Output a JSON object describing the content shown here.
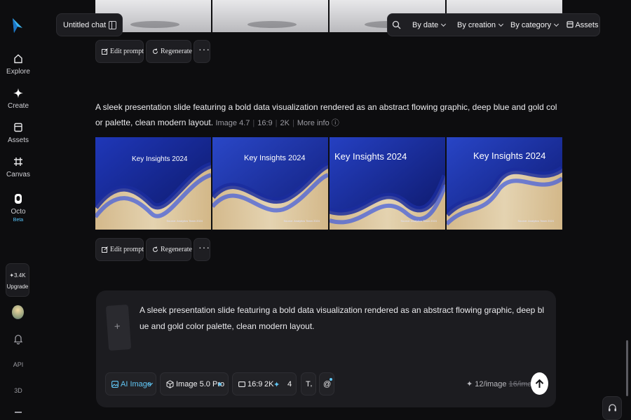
{
  "sidebar": {
    "items": [
      {
        "label": "Explore",
        "icon": "home-icon"
      },
      {
        "label": "Create",
        "icon": "sparkle-icon"
      },
      {
        "label": "Assets",
        "icon": "folder-icon"
      },
      {
        "label": "Canvas",
        "icon": "hash-icon"
      },
      {
        "label": "Octo",
        "icon": "octo-icon",
        "badge": "Beta"
      }
    ],
    "credits": "3.4K",
    "upgrade_label": "Upgrade",
    "api_label": "API",
    "threed_label": "3D"
  },
  "header": {
    "chat_title": "Untitled chat",
    "filters": [
      "By date",
      "By creation",
      "By category"
    ],
    "assets_label": "Assets"
  },
  "result": {
    "prompt": "A sleek presentation slide featuring a bold data visualization rendered as an abstract flowing graphic, deep blue and gold color palette, clean modern layout.",
    "model": "Image 4.7",
    "ratio": "16:9",
    "resolution": "2K",
    "more_info": "More info",
    "slide_title": "Key Insights 2024",
    "slide_source": "Source: Analytics Team 2024",
    "colors": {
      "deep_blue": "#1b2d9e",
      "gold": "#e4c58a"
    }
  },
  "actions": {
    "edit_prompt": "Edit prompt",
    "regenerate": "Regenerate",
    "more": "···"
  },
  "composer": {
    "text": "A sleek presentation slide featuring a bold data visualization rendered as an abstract flowing graphic, deep blue and gold color palette, clean modern layout.",
    "add_symbol": "+",
    "mode": "AI Image",
    "model": "Image 5.0 Pro",
    "ratio": "16:9",
    "resolution": "2K",
    "count": "4",
    "cost": "12/image",
    "cost_old": "16/image",
    "accent": "#61c6f5"
  }
}
